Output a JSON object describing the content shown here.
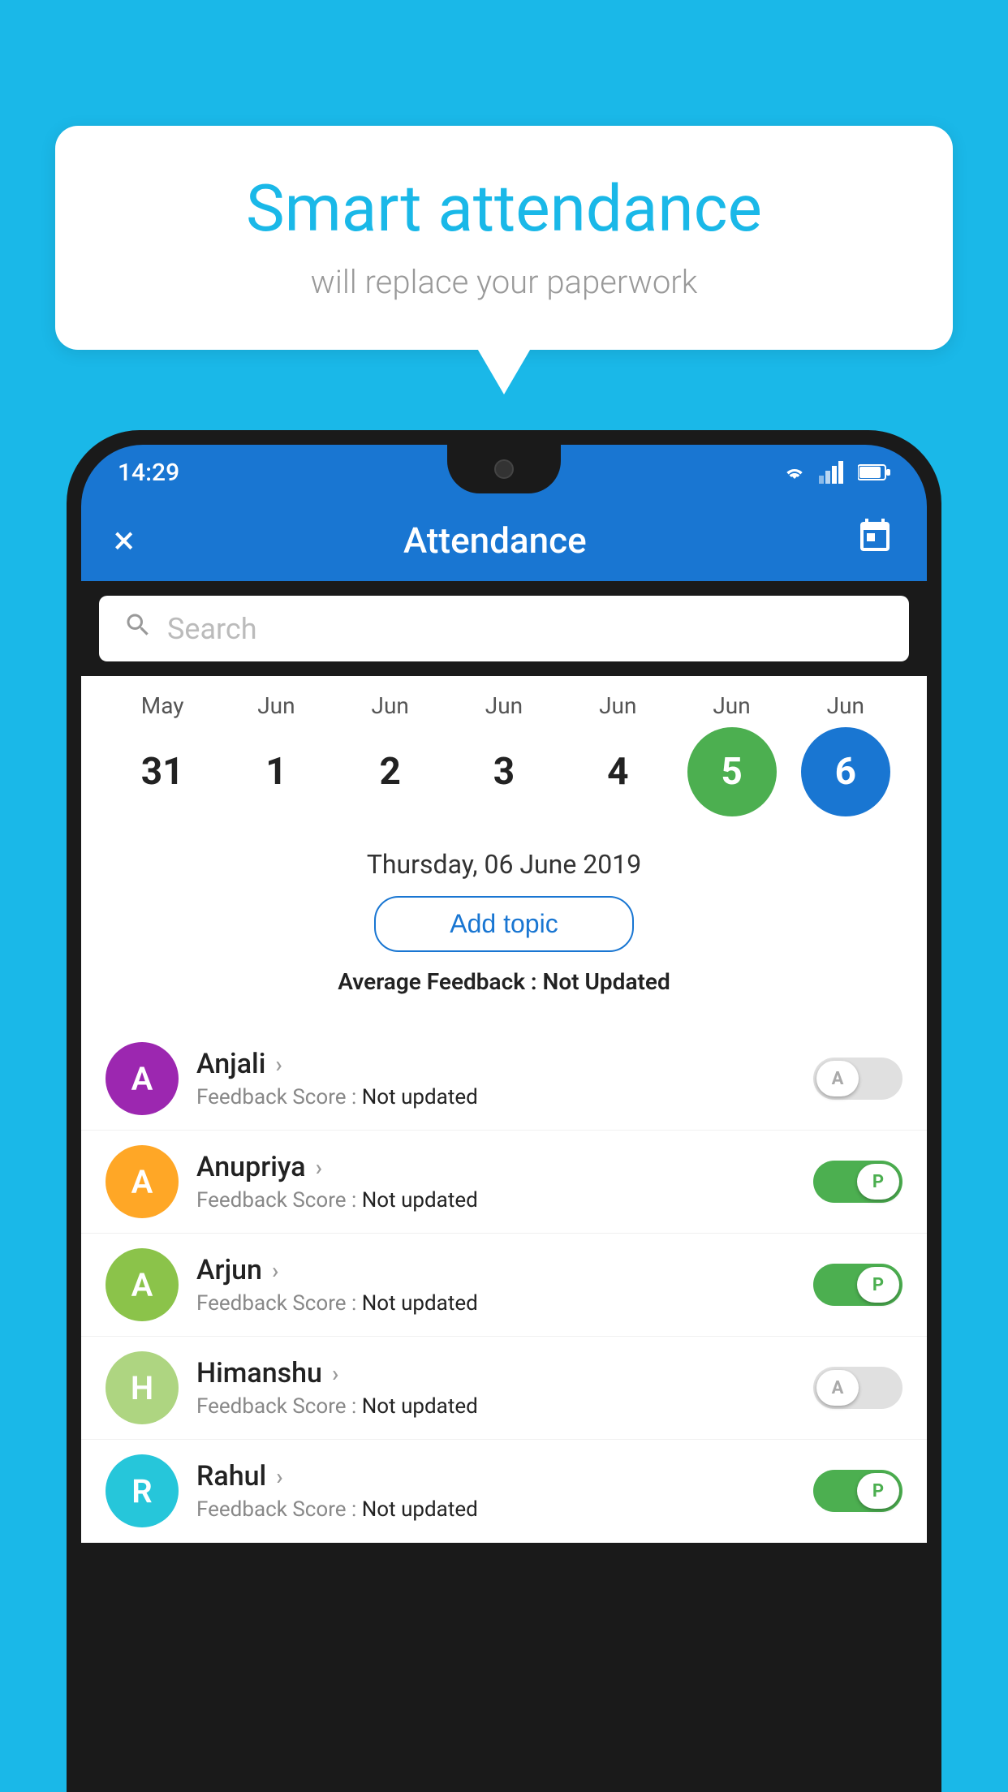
{
  "background_color": "#1ab8e8",
  "bubble": {
    "title": "Smart attendance",
    "subtitle": "will replace your paperwork"
  },
  "status_bar": {
    "time": "14:29",
    "icons": [
      "wifi",
      "signal",
      "battery"
    ]
  },
  "header": {
    "title": "Attendance",
    "close_label": "×",
    "calendar_icon": "📅"
  },
  "search": {
    "placeholder": "Search"
  },
  "calendar": {
    "months": [
      "May",
      "Jun",
      "Jun",
      "Jun",
      "Jun",
      "Jun",
      "Jun"
    ],
    "dates": [
      "31",
      "1",
      "2",
      "3",
      "4",
      "5",
      "6"
    ],
    "today_index": 5,
    "selected_index": 6
  },
  "selected_date_label": "Thursday, 06 June 2019",
  "add_topic_label": "Add topic",
  "avg_feedback_label": "Average Feedback :",
  "avg_feedback_value": "Not Updated",
  "students": [
    {
      "name": "Anjali",
      "avatar_letter": "A",
      "avatar_color": "#9c27b0",
      "feedback_label": "Feedback Score :",
      "feedback_value": "Not updated",
      "attendance": "absent",
      "toggle_label": "A"
    },
    {
      "name": "Anupriya",
      "avatar_letter": "A",
      "avatar_color": "#ffa726",
      "feedback_label": "Feedback Score :",
      "feedback_value": "Not updated",
      "attendance": "present",
      "toggle_label": "P"
    },
    {
      "name": "Arjun",
      "avatar_letter": "A",
      "avatar_color": "#8bc34a",
      "feedback_label": "Feedback Score :",
      "feedback_value": "Not updated",
      "attendance": "present",
      "toggle_label": "P"
    },
    {
      "name": "Himanshu",
      "avatar_letter": "H",
      "avatar_color": "#aed581",
      "feedback_label": "Feedback Score :",
      "feedback_value": "Not updated",
      "attendance": "absent",
      "toggle_label": "A"
    },
    {
      "name": "Rahul",
      "avatar_letter": "R",
      "avatar_color": "#26c6da",
      "feedback_label": "Feedback Score :",
      "feedback_value": "Not updated",
      "attendance": "present",
      "toggle_label": "P"
    }
  ]
}
